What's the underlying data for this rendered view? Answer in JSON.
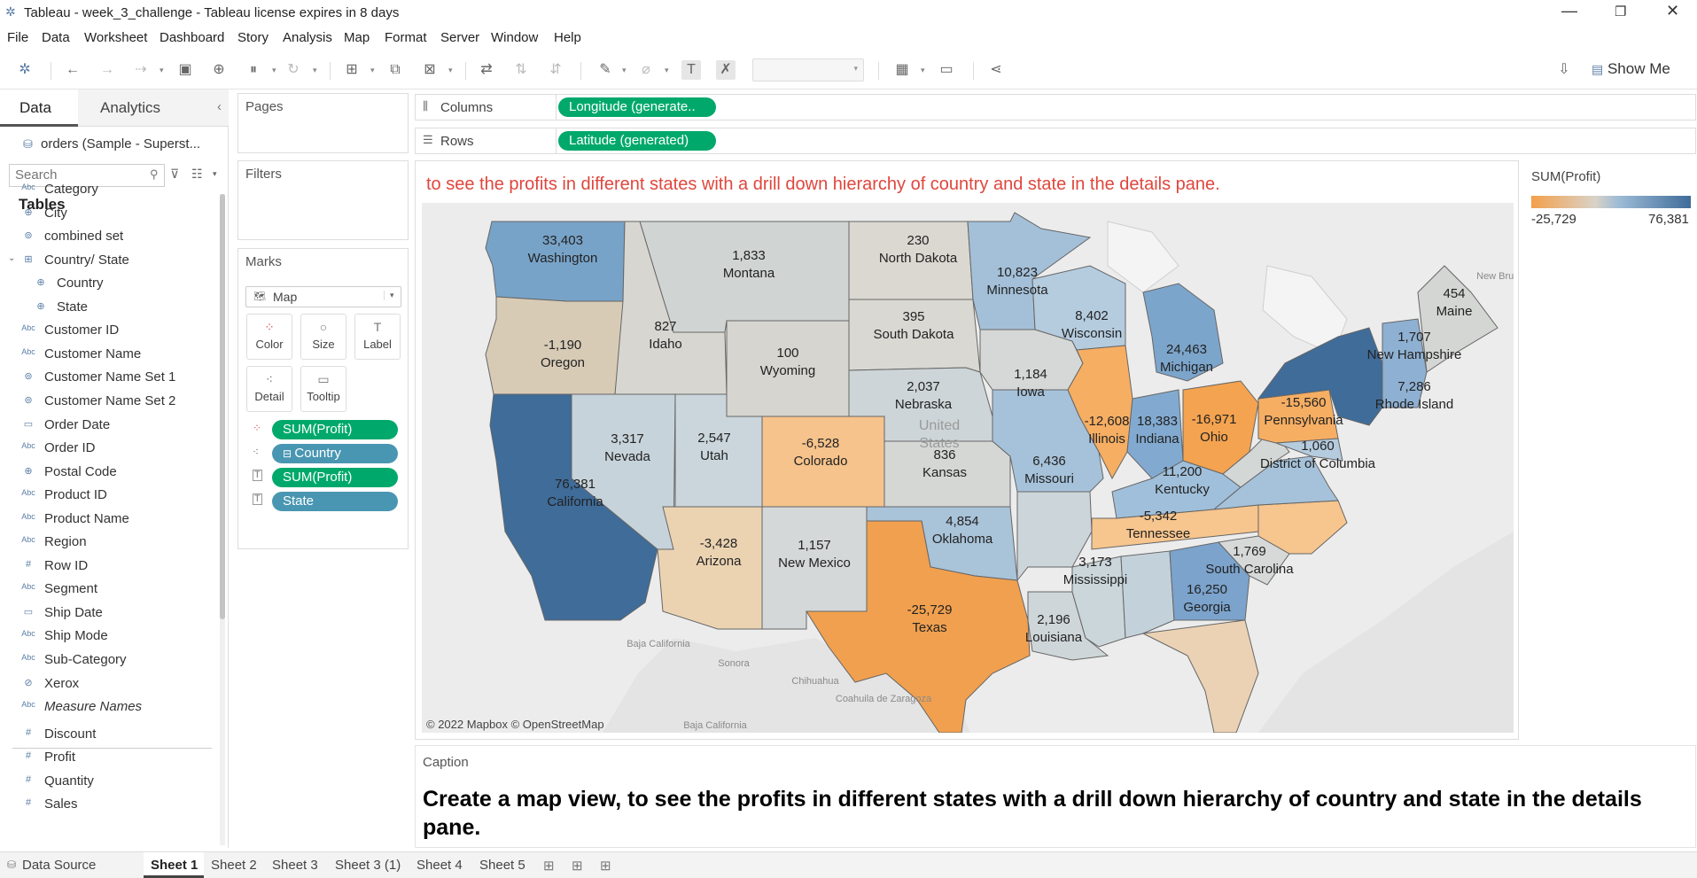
{
  "window": {
    "title": "Tableau - week_3_challenge - Tableau license expires in 8 days"
  },
  "menu": [
    "File",
    "Data",
    "Worksheet",
    "Dashboard",
    "Story",
    "Analysis",
    "Map",
    "Format",
    "Server",
    "Window",
    "Help"
  ],
  "toolbar": {
    "show_me": "Show Me"
  },
  "left_panel": {
    "tab_data": "Data",
    "tab_analytics": "Analytics",
    "datasource": "orders (Sample - Superst...",
    "search_placeholder": "Search",
    "tables_heading": "Tables",
    "fields": [
      {
        "type": "Abc",
        "name": "Category"
      },
      {
        "type": "geo",
        "name": "City"
      },
      {
        "type": "set",
        "name": "combined set"
      },
      {
        "type": "hier",
        "name": "Country/ State"
      },
      {
        "type": "geo",
        "name": "Country"
      },
      {
        "type": "geo",
        "name": "State"
      },
      {
        "type": "Abc",
        "name": "Customer ID"
      },
      {
        "type": "Abc",
        "name": "Customer Name"
      },
      {
        "type": "set",
        "name": "Customer Name Set 1"
      },
      {
        "type": "set",
        "name": "Customer Name Set 2"
      },
      {
        "type": "date",
        "name": "Order Date"
      },
      {
        "type": "Abc",
        "name": "Order ID"
      },
      {
        "type": "geo",
        "name": "Postal Code"
      },
      {
        "type": "Abc",
        "name": "Product ID"
      },
      {
        "type": "Abc",
        "name": "Product Name"
      },
      {
        "type": "Abc",
        "name": "Region"
      },
      {
        "type": "#",
        "name": "Row ID"
      },
      {
        "type": "Abc",
        "name": "Segment"
      },
      {
        "type": "date",
        "name": "Ship Date"
      },
      {
        "type": "Abc",
        "name": "Ship Mode"
      },
      {
        "type": "Abc",
        "name": "Sub-Category"
      },
      {
        "type": "clip",
        "name": "Xerox"
      },
      {
        "type": "Abc",
        "name": "Measure Names"
      },
      {
        "type": "#",
        "name": "Discount"
      },
      {
        "type": "#",
        "name": "Profit"
      },
      {
        "type": "#",
        "name": "Quantity"
      },
      {
        "type": "#",
        "name": "Sales"
      }
    ]
  },
  "shelves": {
    "pages": "Pages",
    "filters": "Filters",
    "marks": "Marks",
    "mark_type": "Map",
    "mark_buttons": [
      "Color",
      "Size",
      "Label",
      "Detail",
      "Tooltip"
    ],
    "mark_pills": [
      "SUM(Profit)",
      "Country",
      "SUM(Profit)",
      "State"
    ],
    "columns_label": "Columns",
    "columns_pill": "Longitude (generate..",
    "rows_label": "Rows",
    "rows_pill": "Latitude (generated)"
  },
  "view": {
    "title": "to see the profits in different states with a drill down hierarchy of country and state in the details pane.",
    "attribution": "© 2022 Mapbox © OpenStreetMap",
    "country_label": [
      "United",
      "States"
    ],
    "bg_labels": [
      "Baja California",
      "Sonora",
      "Chihuahua",
      "Coahuila de Zaragoza",
      "Baja California",
      "New Brunsw"
    ]
  },
  "legend": {
    "title": "SUM(Profit)",
    "min": "-25,729",
    "max": "76,381",
    "color_low": "#f3a04a",
    "color_high": "#3f6c99"
  },
  "caption": {
    "label": "Caption",
    "text": "Create a map view, to see the profits in different states with a drill down hierarchy of country and state in the details pane."
  },
  "sheets": {
    "datasource": "Data Source",
    "tabs": [
      "Sheet 1",
      "Sheet 2",
      "Sheet 3",
      "Sheet 3 (1)",
      "Sheet 4",
      "Sheet 5"
    ]
  },
  "state_labels": [
    {
      "name": "Washington",
      "value": "33,403"
    },
    {
      "name": "Oregon",
      "value": "-1,190"
    },
    {
      "name": "California",
      "value": "76,381"
    },
    {
      "name": "Montana",
      "value": "1,833"
    },
    {
      "name": "Idaho",
      "value": "827"
    },
    {
      "name": "Nevada",
      "value": "3,317"
    },
    {
      "name": "Wyoming",
      "value": "100"
    },
    {
      "name": "Utah",
      "value": "2,547"
    },
    {
      "name": "Arizona",
      "value": "-3,428"
    },
    {
      "name": "Colorado",
      "value": "-6,528"
    },
    {
      "name": "New Mexico",
      "value": "1,157"
    },
    {
      "name": "North Dakota",
      "value": "230"
    },
    {
      "name": "South Dakota",
      "value": "395"
    },
    {
      "name": "Nebraska",
      "value": "2,037"
    },
    {
      "name": "Kansas",
      "value": "836"
    },
    {
      "name": "Oklahoma",
      "value": "4,854"
    },
    {
      "name": "Texas",
      "value": "-25,729"
    },
    {
      "name": "Minnesota",
      "value": "10,823"
    },
    {
      "name": "Iowa",
      "value": "1,184"
    },
    {
      "name": "Missouri",
      "value": "6,436"
    },
    {
      "name": "Louisiana",
      "value": "2,196"
    },
    {
      "name": "Wisconsin",
      "value": "8,402"
    },
    {
      "name": "Illinois",
      "value": "-12,608"
    },
    {
      "name": "Michigan",
      "value": "24,463"
    },
    {
      "name": "Indiana",
      "value": "18,383"
    },
    {
      "name": "Ohio",
      "value": "-16,971"
    },
    {
      "name": "Kentucky",
      "value": "11,200"
    },
    {
      "name": "Tennessee",
      "value": "-5,342"
    },
    {
      "name": "Mississippi",
      "value": "3,173"
    },
    {
      "name": "Georgia",
      "value": "16,250"
    },
    {
      "name": "South Carolina",
      "value": "1,769"
    },
    {
      "name": "Pennsylvania",
      "value": "-15,560"
    },
    {
      "name": "District of Columbia",
      "value": "1,060"
    },
    {
      "name": "New Hampshire",
      "value": "1,707"
    },
    {
      "name": "Rhode Island",
      "value": "7,286"
    },
    {
      "name": "Maine",
      "value": "454"
    }
  ]
}
